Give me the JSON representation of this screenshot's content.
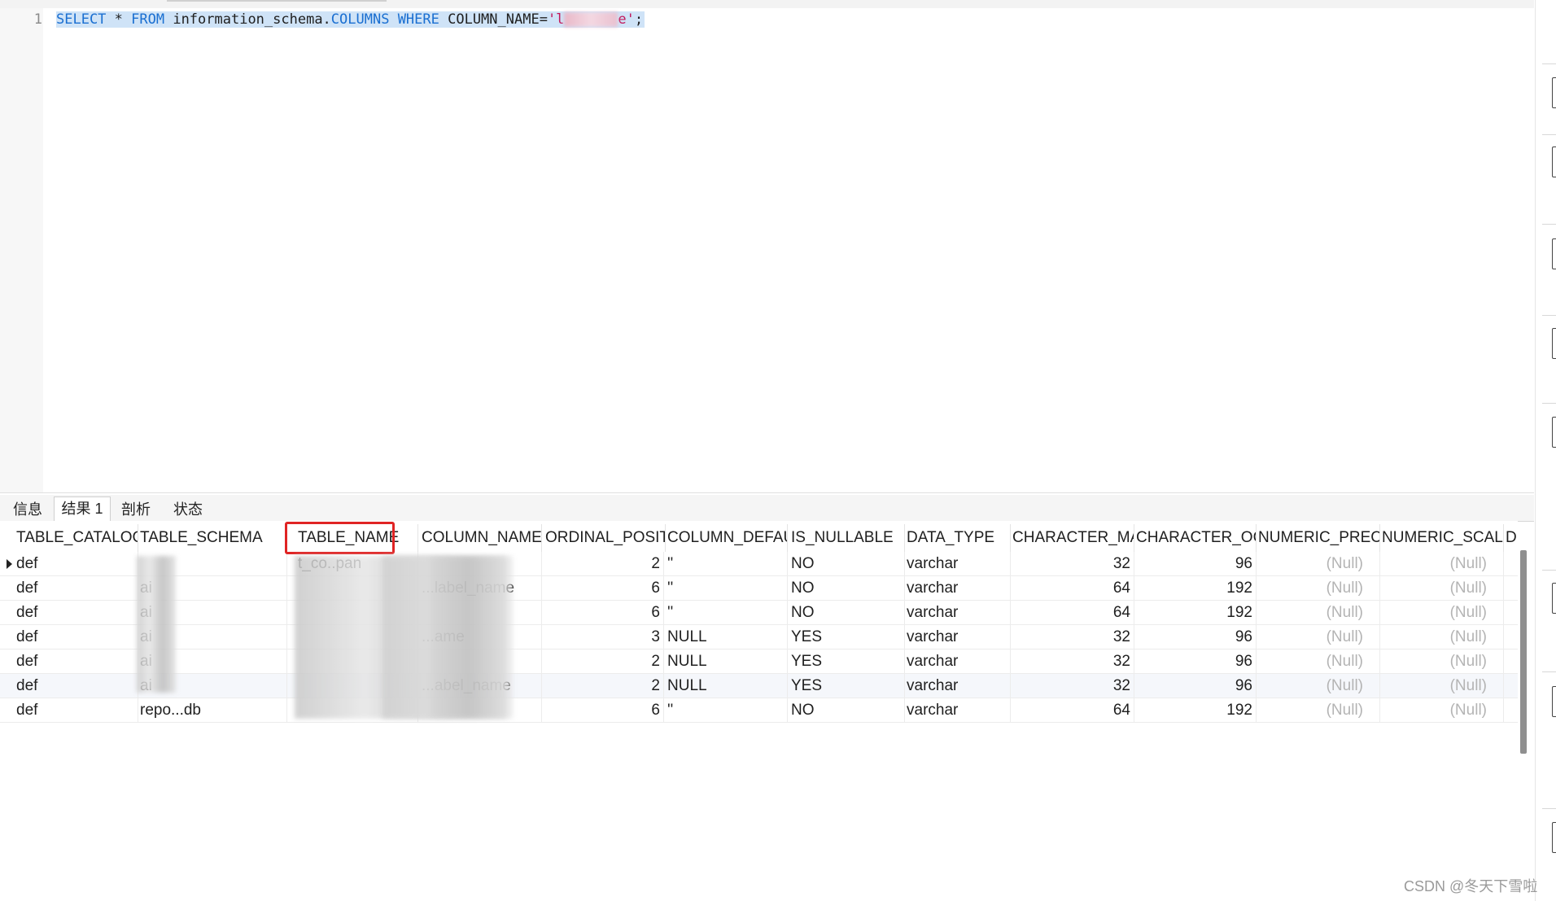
{
  "editor": {
    "line_number": "1",
    "query": {
      "kw_select": "SELECT",
      "star": " * ",
      "kw_from": "FROM",
      "table": " information_schema.",
      "columns_kw": "COLUMNS",
      "kw_where": " WHERE ",
      "column_eq": "COLUMN_NAME=",
      "str_start": "'l",
      "str_end": "e'",
      "terminator": ";"
    }
  },
  "tabs": [
    "信息",
    "结果 1",
    "剖析",
    "状态"
  ],
  "active_tab": "结果 1",
  "grid": {
    "headers": [
      "TABLE_CATALOG",
      "TABLE_SCHEMA",
      "TABLE_NAME",
      "COLUMN_NAME",
      "ORDINAL_POSITI",
      "COLUMN_DEFAU",
      "IS_NULLABLE",
      "DATA_TYPE",
      "CHARACTER_MA",
      "CHARACTER_OC",
      "NUMERIC_PRECI",
      "NUMERIC_SCALE",
      "D"
    ],
    "rows": [
      {
        "catalog": "def",
        "schema": "",
        "table": "t_co..pan",
        "column": "",
        "ordinal": "2",
        "default": "''",
        "nullable": "NO",
        "type": "varchar",
        "char_max": "32",
        "char_oct": "96",
        "num_prec": "(Null)",
        "num_scale": "(Null)"
      },
      {
        "catalog": "def",
        "schema": "ai",
        "table": "",
        "column": "...label_name",
        "ordinal": "6",
        "default": "''",
        "nullable": "NO",
        "type": "varchar",
        "char_max": "64",
        "char_oct": "192",
        "num_prec": "(Null)",
        "num_scale": "(Null)"
      },
      {
        "catalog": "def",
        "schema": "ai",
        "table": "",
        "column": "",
        "ordinal": "6",
        "default": "''",
        "nullable": "NO",
        "type": "varchar",
        "char_max": "64",
        "char_oct": "192",
        "num_prec": "(Null)",
        "num_scale": "(Null)"
      },
      {
        "catalog": "def",
        "schema": "ai",
        "table": "",
        "column": "...ame",
        "ordinal": "3",
        "default": "NULL",
        "nullable": "YES",
        "type": "varchar",
        "char_max": "32",
        "char_oct": "96",
        "num_prec": "(Null)",
        "num_scale": "(Null)"
      },
      {
        "catalog": "def",
        "schema": "ai",
        "table": "",
        "column": "",
        "ordinal": "2",
        "default": "NULL",
        "nullable": "YES",
        "type": "varchar",
        "char_max": "32",
        "char_oct": "96",
        "num_prec": "(Null)",
        "num_scale": "(Null)"
      },
      {
        "catalog": "def",
        "schema": "ai",
        "table": "",
        "column": "...abel_name",
        "ordinal": "2",
        "default": "NULL",
        "nullable": "YES",
        "type": "varchar",
        "char_max": "32",
        "char_oct": "96",
        "num_prec": "(Null)",
        "num_scale": "(Null)"
      },
      {
        "catalog": "def",
        "schema": "repo...db",
        "table": "",
        "column": "",
        "ordinal": "6",
        "default": "''",
        "nullable": "NO",
        "type": "varchar",
        "char_max": "64",
        "char_oct": "192",
        "num_prec": "(Null)",
        "num_scale": "(Null)"
      }
    ]
  },
  "watermark": "CSDN @冬天下雪啦",
  "colors": {
    "keyword": "#1a6fd1",
    "string": "#c2185b",
    "selection": "#cfe3f7",
    "highlight_box": "#e02424",
    "null_text": "#b4b4b4"
  }
}
